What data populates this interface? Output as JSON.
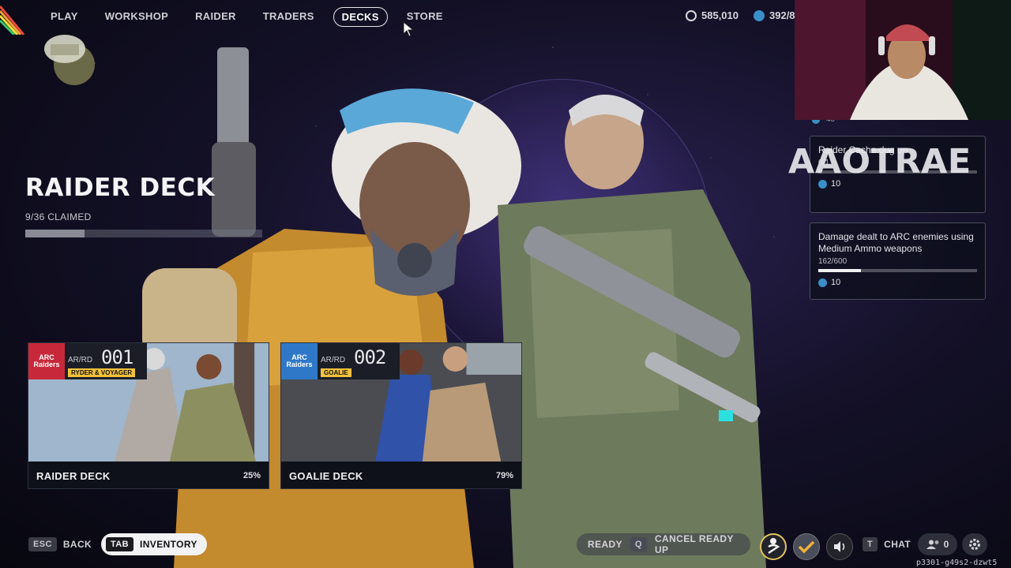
{
  "nav": {
    "items": [
      {
        "label": "PLAY",
        "active": false
      },
      {
        "label": "WORKSHOP",
        "active": false
      },
      {
        "label": "RAIDER",
        "active": false
      },
      {
        "label": "TRADERS",
        "active": false
      },
      {
        "label": "DECKS",
        "active": true
      },
      {
        "label": "STORE",
        "active": false
      }
    ]
  },
  "currency": {
    "coins": "585,010",
    "tokens": "392/8"
  },
  "deck": {
    "title": "RAIDER DECK",
    "claimed": "9/36 CLAIMED",
    "claimed_fraction": 0.25
  },
  "cards": [
    {
      "brand": "ARC Raiders",
      "prefix": "AR/RD",
      "number": "001",
      "tagline": "RYDER & VOYAGER",
      "name": "RAIDER DECK",
      "percent": "25%",
      "badge_color": "#c8293a"
    },
    {
      "brand": "ARC Raiders",
      "prefix": "AR/RD",
      "number": "002",
      "tagline": "GOALIE",
      "name": "GOALIE DECK",
      "percent": "79%",
      "badge_color": "#2f78c8"
    }
  ],
  "quests": {
    "peek_reward": "40",
    "a": {
      "description": "Raider Cache dug up",
      "progress": "0/1",
      "progress_fraction": 0,
      "reward": "10"
    },
    "b": {
      "description": "Damage dealt to ARC enemies using Medium Ammo weapons",
      "progress": "162/600",
      "progress_fraction": 0.27,
      "reward": "10"
    }
  },
  "overlay": {
    "streamer_name": "AAOTRAE",
    "session_id": "p3301-g49s2-dzwt5"
  },
  "bottom": {
    "back_key": "ESC",
    "back_label": "BACK",
    "inventory_key": "TAB",
    "inventory_label": "INVENTORY",
    "ready_label": "READY",
    "cancel_key": "Q",
    "cancel_label": "CANCEL READY UP",
    "chat_key": "T",
    "chat_label": "CHAT",
    "friends_count": "0"
  },
  "colors": {
    "accent": "#f2c23a",
    "background": "#141128"
  },
  "icons": {
    "coin": "coin-icon",
    "token": "token-icon",
    "settings": "gear-icon",
    "friends": "friends-icon"
  }
}
